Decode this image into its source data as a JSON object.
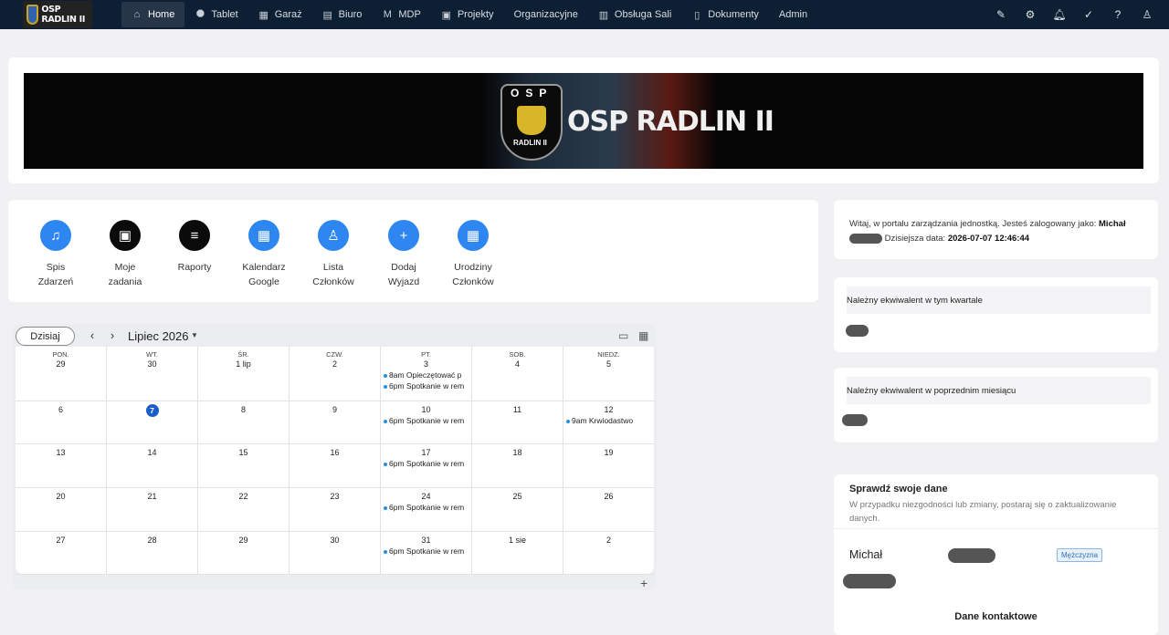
{
  "navbar": {
    "brand": "OSP RADLIN II",
    "items": [
      {
        "label": "Home",
        "icon": "home-icon",
        "glyph": "⌂"
      },
      {
        "label": "Tablet",
        "icon": "tablet-icon",
        "glyph": "⯃"
      },
      {
        "label": "Garaż",
        "icon": "garage-icon",
        "glyph": "▦"
      },
      {
        "label": "Biuro",
        "icon": "office-icon",
        "glyph": "▤"
      },
      {
        "label": "MDP",
        "icon": "mdp-icon",
        "glyph": "M"
      },
      {
        "label": "Projekty",
        "icon": "projects-icon",
        "glyph": "▣"
      },
      {
        "label": "Organizacyjne",
        "icon": "",
        "glyph": ""
      },
      {
        "label": "Obsługa Sali",
        "icon": "hall-icon",
        "glyph": "▥"
      },
      {
        "label": "Dokumenty",
        "icon": "documents-icon",
        "glyph": "▯"
      },
      {
        "label": "Admin",
        "icon": "",
        "glyph": ""
      }
    ]
  },
  "banner": {
    "osp": "OSP",
    "sub": "RADLIN II",
    "title": "OSP RADLIN II"
  },
  "actions": [
    {
      "label1": "Spis",
      "label2": "Zdarzeń",
      "icon": "siren-icon",
      "glyph": "♫",
      "dark": false
    },
    {
      "label1": "Moje",
      "label2": "zadania",
      "icon": "tasks-icon",
      "glyph": "▣",
      "dark": true
    },
    {
      "label1": "Raporty",
      "label2": "",
      "icon": "reports-icon",
      "glyph": "≡",
      "dark": true
    },
    {
      "label1": "Kalendarz",
      "label2": "Google",
      "icon": "calendar-icon",
      "glyph": "▦",
      "dark": false
    },
    {
      "label1": "Lista",
      "label2": "Członków",
      "icon": "members-icon",
      "glyph": "♙",
      "dark": false
    },
    {
      "label1": "Dodaj",
      "label2": "Wyjazd",
      "icon": "add-icon",
      "glyph": "+",
      "dark": false
    },
    {
      "label1": "Urodziny",
      "label2": "Członków",
      "icon": "birthday-calendar-icon",
      "glyph": "▦",
      "dark": false
    }
  ],
  "calendar": {
    "today_label": "Dzisiaj",
    "month": "Lipiec 2026",
    "weekdays": [
      "PON.",
      "WT.",
      "ŚR.",
      "CZW.",
      "PT.",
      "SOB.",
      "NIEDZ."
    ],
    "weeks": [
      [
        {
          "day": "29",
          "events": []
        },
        {
          "day": "30",
          "events": []
        },
        {
          "day": "1 lip",
          "events": []
        },
        {
          "day": "2",
          "events": []
        },
        {
          "day": "3",
          "events": [
            {
              "time": "8am",
              "title": "Opieczętować p"
            },
            {
              "time": "6pm",
              "title": "Spotkanie w rem"
            }
          ]
        },
        {
          "day": "4",
          "events": []
        },
        {
          "day": "5",
          "events": []
        }
      ],
      [
        {
          "day": "6",
          "events": []
        },
        {
          "day": "7",
          "today": true,
          "events": []
        },
        {
          "day": "8",
          "events": []
        },
        {
          "day": "9",
          "events": []
        },
        {
          "day": "10",
          "events": [
            {
              "time": "6pm",
              "title": "Spotkanie w rem"
            }
          ]
        },
        {
          "day": "11",
          "events": []
        },
        {
          "day": "12",
          "events": [
            {
              "time": "9am",
              "title": "Krwiodastwo"
            }
          ]
        }
      ],
      [
        {
          "day": "13",
          "events": []
        },
        {
          "day": "14",
          "events": []
        },
        {
          "day": "15",
          "events": []
        },
        {
          "day": "16",
          "events": []
        },
        {
          "day": "17",
          "events": [
            {
              "time": "6pm",
              "title": "Spotkanie w rem"
            }
          ]
        },
        {
          "day": "18",
          "events": []
        },
        {
          "day": "19",
          "events": []
        }
      ],
      [
        {
          "day": "20",
          "events": []
        },
        {
          "day": "21",
          "events": []
        },
        {
          "day": "22",
          "events": []
        },
        {
          "day": "23",
          "events": []
        },
        {
          "day": "24",
          "events": [
            {
              "time": "6pm",
              "title": "Spotkanie w rem"
            }
          ]
        },
        {
          "day": "25",
          "events": []
        },
        {
          "day": "26",
          "events": []
        }
      ],
      [
        {
          "day": "27",
          "events": []
        },
        {
          "day": "28",
          "events": []
        },
        {
          "day": "29",
          "events": []
        },
        {
          "day": "30",
          "events": []
        },
        {
          "day": "31",
          "events": [
            {
              "time": "6pm",
              "title": "Spotkanie w rem"
            }
          ]
        },
        {
          "day": "1 sie",
          "events": []
        },
        {
          "day": "2",
          "events": []
        }
      ]
    ]
  },
  "welcome": {
    "text": "Witaj, w portalu zarządzania jednostką. Jesteś zalogowany jako:",
    "user": "Michał",
    "date_label": "Dzisiejsza data:",
    "date": "2026-07-07 12:46:44"
  },
  "equivalent": {
    "quarter_label": "Należny ekwiwalent w tym kwartale",
    "prev_month_label": "Należny ekwiwalent w poprzednim miesiącu"
  },
  "profile": {
    "title": "Sprawdź swoje dane",
    "subtitle": "W przypadku niezgodności lub zmiany, postaraj się o zaktualizowanie danych.",
    "first_name": "Michał",
    "gender": "Mężczyzna",
    "contact_header": "Dane kontaktowe"
  }
}
